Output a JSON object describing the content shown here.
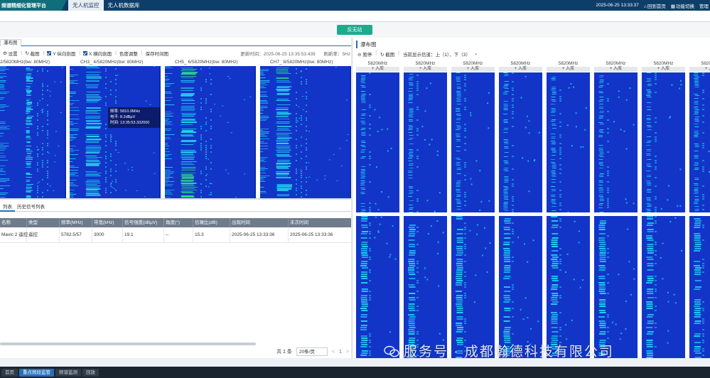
{
  "topbar": {
    "app_title": "频谱精细化管理平台",
    "tabs": [
      {
        "label": "无人机监控",
        "active": true
      },
      {
        "label": "无人机数据库",
        "active": false
      }
    ],
    "datetime": "2025-06-25 13:33:37",
    "home_label": "回到首页",
    "switch_label": "功能切换",
    "admin_label": "管理"
  },
  "action": {
    "counter_button": "反无站"
  },
  "left": {
    "panel_tab": "瀑布图",
    "toolbar": {
      "settings": "设置",
      "screenshot": "截图",
      "y_profile": "Y 纵向剖面",
      "x_profile": "X 横向剖面",
      "color_adjust": "色度调整",
      "save_hold": "保存时间图",
      "update_time": "更新时间：2025-06-25 13:35:53.439",
      "refresh_rate": "刷新率：5Hz"
    },
    "waterfall_labels": [
      "2/5820MHz(bw: 80MHz)",
      "CH3_ 4/5820MHz(bw: 80MHz)",
      "CH5_ 6/5820MHz(bw: 80MHz)",
      "CH7_ 8/5820MHz(bw: 80MHz)"
    ],
    "tooltip": {
      "freq": "频率: 5810.0MHz",
      "level": "电平: 8.2dBμV",
      "time": "时间: 13:35:53.332000"
    }
  },
  "signal_list": {
    "tabs": [
      {
        "label": "列表",
        "active": true
      },
      {
        "label": "历史信号列表",
        "active": false
      }
    ],
    "columns": [
      "名称",
      "类型",
      "频率(MHz)",
      "带宽(kHz)",
      "信号强度(dBμV)",
      "角度(°)",
      "信噪比(dB)",
      "出现时间",
      "末次时间"
    ],
    "rows": [
      [
        "Mavic 2 遥控",
        "遥控",
        "5782.5/57",
        "3000",
        "19.1",
        "--",
        "15.3",
        "2025-06-25 13:33:36",
        "2025-06-25 13:33:36"
      ]
    ],
    "pager": {
      "total": "共 1 条",
      "page_size": "20条/页",
      "prev": "<",
      "current_page": "1",
      "next": ">"
    }
  },
  "right": {
    "title": "瀑布图",
    "toolbar": {
      "pause": "暂停",
      "screenshot": "截图",
      "current_display": "当前显示信道：上（1）、下（3）"
    },
    "columns": [
      {
        "freq": "5820MHz",
        "action": "入库"
      },
      {
        "freq": "5820MHz",
        "action": "入库"
      },
      {
        "freq": "5820MHz",
        "action": "入库"
      },
      {
        "freq": "5820MHz",
        "action": "入库"
      },
      {
        "freq": "5820MHz",
        "action": "入库"
      },
      {
        "freq": "5820MHz",
        "action": "入库"
      },
      {
        "freq": "5820MHz",
        "action": "入库"
      },
      {
        "freq": "5820MHz",
        "action": "入库"
      }
    ]
  },
  "bottombar": {
    "tabs": [
      {
        "label": "首页",
        "active": false
      },
      {
        "label": "重点频段监管",
        "active": true
      },
      {
        "label": "频谱监测",
        "active": false
      },
      {
        "label": "回放",
        "active": false
      }
    ]
  },
  "watermark": "服务号 · 成都瀚德科技有限公司",
  "colors": {
    "waterfall_bg": "#1235c8",
    "signal_cyan": "#22d4f0",
    "signal_green": "#2bd88a",
    "topbar": "#0d3e6a",
    "accent": "#2a6fb6",
    "counter_button": "#1faa8e"
  }
}
